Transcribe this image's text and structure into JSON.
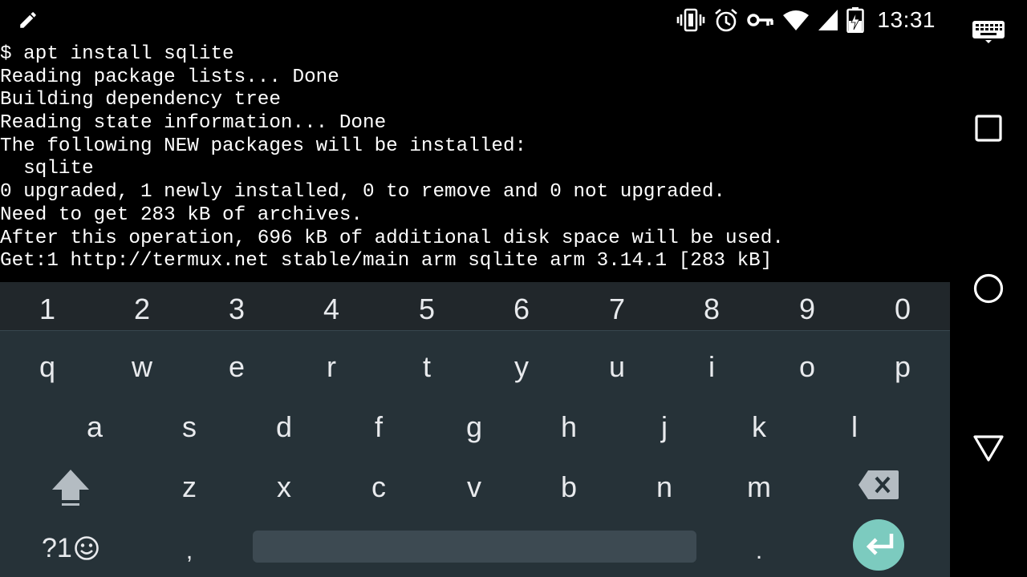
{
  "status_bar": {
    "time": "13:31",
    "icons": [
      "edit-icon",
      "vibrate-icon",
      "alarm-icon",
      "vpn-key-icon",
      "wifi-icon",
      "signal-icon",
      "battery-charging-icon"
    ]
  },
  "terminal": {
    "lines": [
      "$ apt install sqlite",
      "Reading package lists... Done",
      "Building dependency tree",
      "Reading state information... Done",
      "The following NEW packages will be installed:",
      "  sqlite",
      "0 upgraded, 1 newly installed, 0 to remove and 0 not upgraded.",
      "Need to get 283 kB of archives.",
      "After this operation, 696 kB of additional disk space will be used.",
      "Get:1 http://termux.net stable/main arm sqlite arm 3.14.1 [283 kB]"
    ]
  },
  "keyboard": {
    "numbers": [
      "1",
      "2",
      "3",
      "4",
      "5",
      "6",
      "7",
      "8",
      "9",
      "0"
    ],
    "row1": [
      "q",
      "w",
      "e",
      "r",
      "t",
      "y",
      "u",
      "i",
      "o",
      "p"
    ],
    "row2": [
      "a",
      "s",
      "d",
      "f",
      "g",
      "h",
      "j",
      "k",
      "l"
    ],
    "row3": [
      "z",
      "x",
      "c",
      "v",
      "b",
      "n",
      "m"
    ],
    "symbols_label": "?1",
    "comma": ",",
    "period": ".",
    "icons": [
      "shift-icon",
      "backspace-icon",
      "emoji-icon",
      "enter-icon"
    ]
  },
  "nav_bar": {
    "icons": [
      "keyboard-icon",
      "recents-icon",
      "home-icon",
      "back-icon"
    ]
  },
  "colors": {
    "terminal_bg": "#000000",
    "terminal_fg": "#ffffff",
    "keyboard_bg": "#263238",
    "number_row_bg": "#21272b",
    "key_text": "#e8eaed",
    "enter_accent": "#7ccbbf"
  }
}
